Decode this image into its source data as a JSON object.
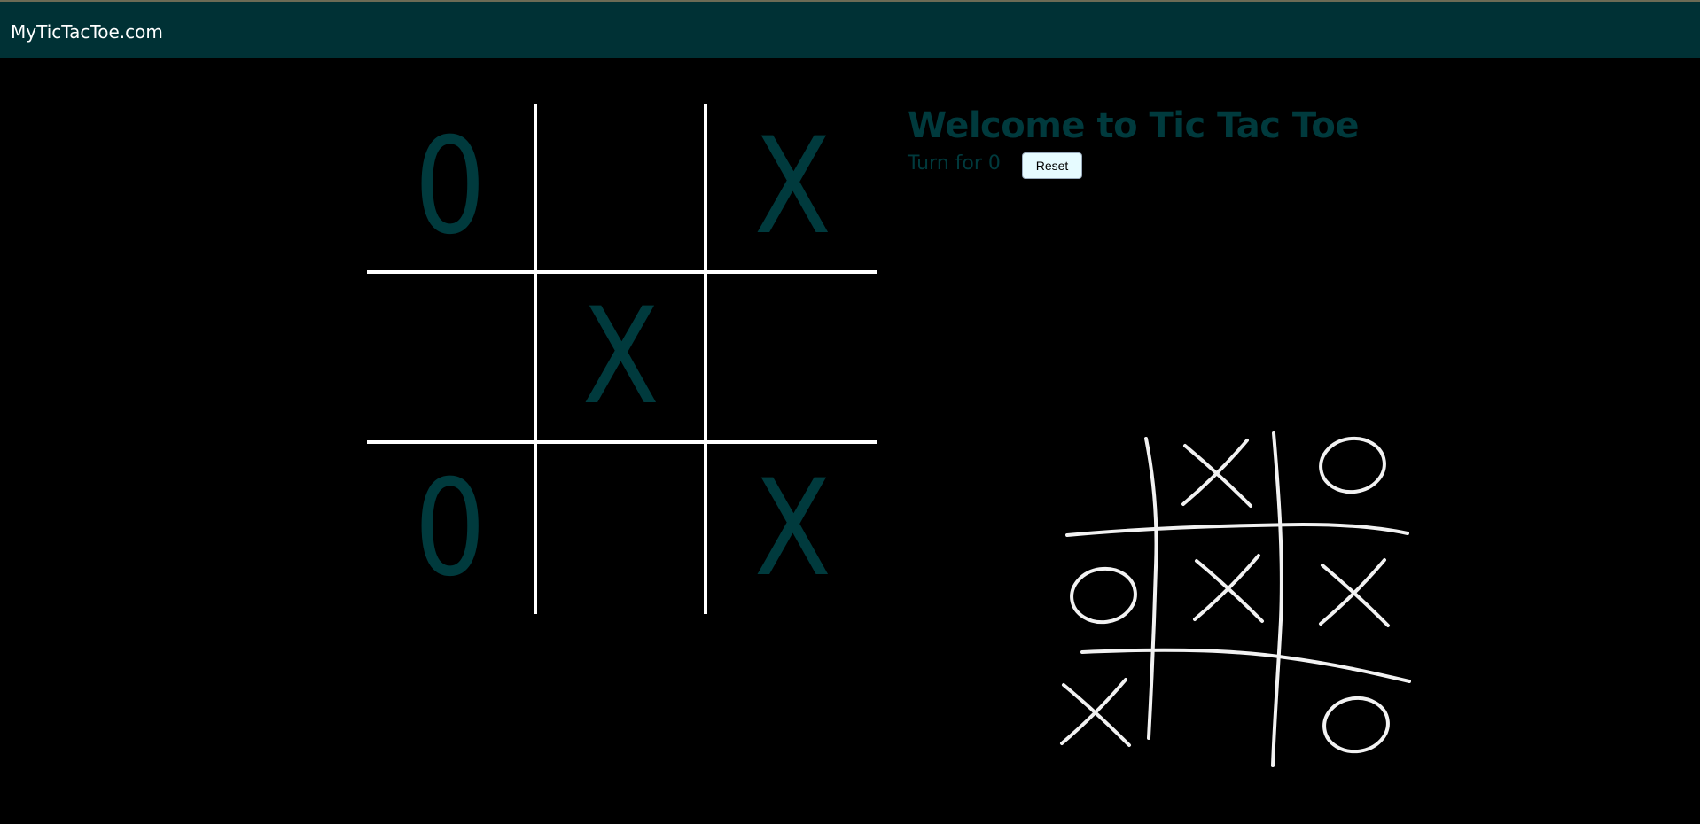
{
  "header": {
    "brand": "MyTicTacToe.com"
  },
  "game": {
    "title": "Welcome to Tic Tac Toe",
    "turn_text": "Turn for 0",
    "reset_label": "Reset",
    "board": [
      "0",
      "",
      "X",
      "",
      "X",
      "",
      "0",
      "",
      "X"
    ]
  },
  "illustration": {
    "icon": "hand-drawn-tic-tac-toe-icon",
    "grid": [
      "",
      "X",
      "O",
      "O",
      "X",
      "X",
      "X",
      "",
      "O"
    ]
  },
  "colors": {
    "navbar": "#003135",
    "accent_text": "#003a3d",
    "background": "#000000",
    "board_lines": "#ffffff",
    "button_bg": "#e6fbff"
  }
}
